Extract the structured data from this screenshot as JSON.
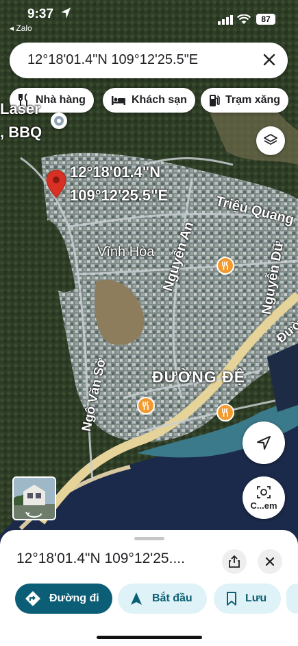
{
  "status_bar": {
    "time": "9:37",
    "back_app": "◂ Zalo",
    "battery": "87"
  },
  "search": {
    "query": "12°18'01.4\"N 109°12'25.5\"E"
  },
  "chips": [
    {
      "label": "Nhà hàng",
      "icon": "restaurant-icon"
    },
    {
      "label": "Khách sạn",
      "icon": "hotel-icon"
    },
    {
      "label": "Trạm xăng",
      "icon": "gas-station-icon"
    }
  ],
  "map": {
    "pin_label_line1": "12°18'01.4\"N",
    "pin_label_line2": "109°12'25.5\"E",
    "poi_left_line1": "Laser",
    "poi_left_line2": ", BBQ",
    "labels": {
      "trieu_quang": "Triệu Quang",
      "vinh_hoa": "Vĩnh Hòa",
      "nguyen_an": "Nguyễn An",
      "nguyen_du": "Nguyễn Dữ",
      "duong_de": "ĐƯỜNG ĐỆ",
      "ngo_van_so": "Ngô Văn Sở",
      "duong": "Đườ"
    },
    "camera_label": "C...em"
  },
  "sheet": {
    "title": "12°18'01.4\"N 109°12'25....",
    "actions": [
      {
        "label": "Đường đi",
        "icon": "directions-icon"
      },
      {
        "label": "Bắt đầu",
        "icon": "navigation-arrow-icon"
      },
      {
        "label": "Lưu",
        "icon": "bookmark-icon"
      }
    ]
  },
  "colors": {
    "primary": "#0b5e75",
    "chip_light": "#dff2f7",
    "pin": "#d93025",
    "food": "#f29a2e"
  }
}
